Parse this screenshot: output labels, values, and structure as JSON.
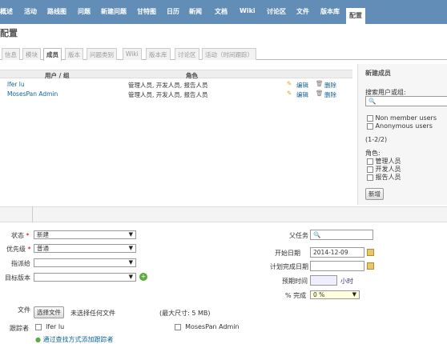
{
  "topnav": {
    "items": [
      "概述",
      "活动",
      "路线图",
      "问题",
      "新建问题",
      "甘特图",
      "日历",
      "新闻",
      "文档",
      "Wiki",
      "讨论区",
      "文件",
      "版本库",
      "配置"
    ],
    "selected_index": 13,
    "background_color": "#628db6"
  },
  "page": {
    "title": "配置"
  },
  "tabs": {
    "items": [
      "信息",
      "模块",
      "成员",
      "版本",
      "问题类别",
      "Wiki",
      "版本库",
      "讨论区",
      "活动（时间跟踪）"
    ],
    "active_index": 2
  },
  "members": {
    "col_user": "用户 / 组",
    "col_role": "角色",
    "rows": [
      {
        "name": "lfer lu",
        "roles": "管理人员, 开发人员, 报告人员",
        "edit": "编辑",
        "delete": "删除"
      },
      {
        "name": "MosesPan Admin",
        "roles": "管理人员, 开发人员, 报告人员",
        "edit": "编辑",
        "delete": "删除"
      }
    ]
  },
  "sidebar": {
    "title": "新建成员",
    "search_label": "搜索用户或组:",
    "options": [
      "Non member users",
      "Anonymous users"
    ],
    "count": "(1-2/2)",
    "roles_label": "角色:",
    "roles": [
      "管理人员",
      "开发人员",
      "报告人员"
    ],
    "button": "新增"
  },
  "issue_form": {
    "status_label": "状态",
    "status_value": "新建",
    "priority_label": "优先级",
    "priority_value": "普通",
    "assignee_label": "指派给",
    "assignee_value": "",
    "version_label": "目标版本",
    "version_value": "",
    "parent_label": "父任务",
    "start_label": "开始日期",
    "start_value": "2014-12-09",
    "due_label": "计划完成日期",
    "due_value": "",
    "estimate_label": "预期时间",
    "estimate_unit": "小时",
    "done_label": "% 完成",
    "done_value": "0 %",
    "required_mark": "*",
    "file_label": "文件",
    "choose_file": "选择文件",
    "no_file": "未选择任何文件",
    "max_size": "(最大尺寸: 5 MB)",
    "watchers_label": "跟踪者",
    "watchers": [
      "lfer lu",
      "MosesPan Admin"
    ],
    "add_watcher": "通过查找方式添加跟踪者"
  }
}
